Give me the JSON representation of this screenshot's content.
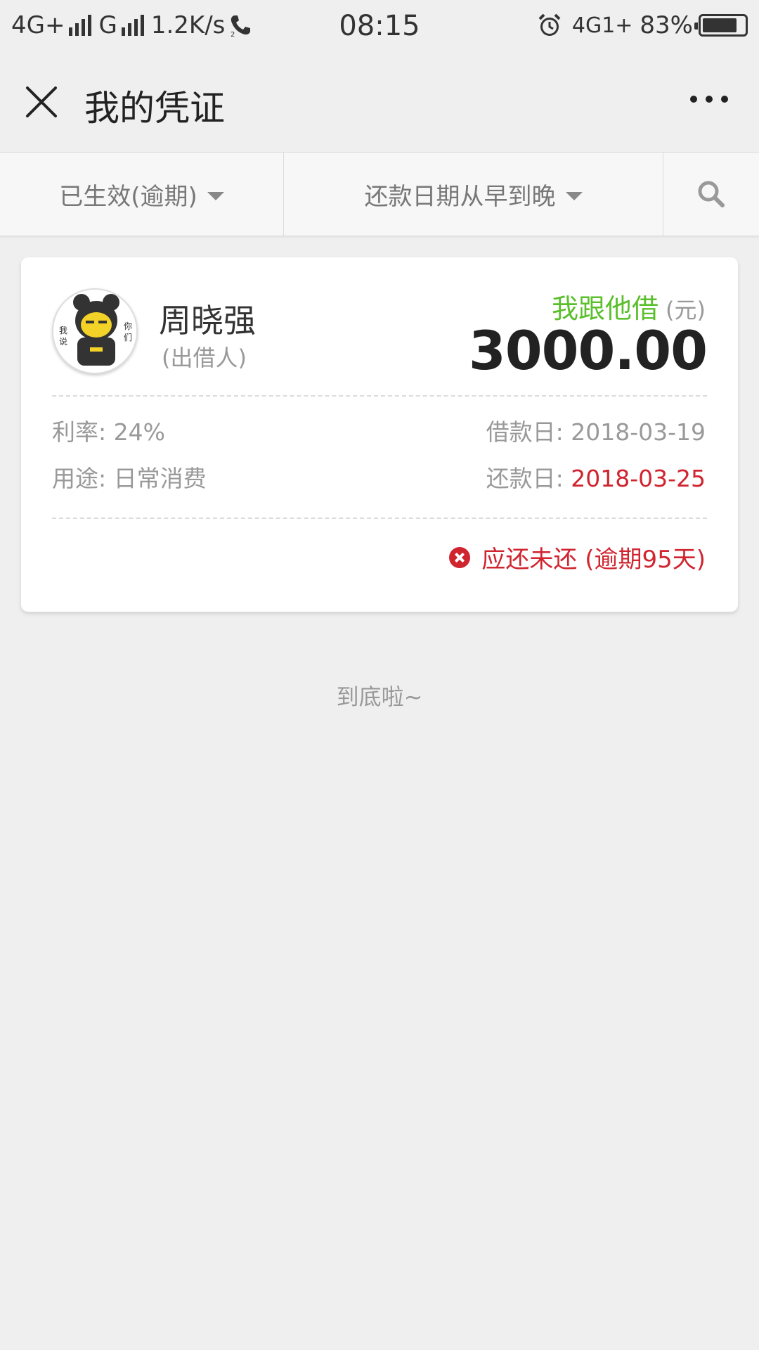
{
  "status_bar": {
    "network_left": "4G+",
    "network_g": "G",
    "speed": "1.2K/s",
    "time": "08:15",
    "network_right": "4G1+",
    "battery": "83%",
    "battery_level": 0.83
  },
  "navbar": {
    "title": "我的凭证"
  },
  "filters": {
    "status": "已生效(逾期)",
    "sort": "还款日期从早到晚"
  },
  "card": {
    "name": "周晓强",
    "role": "(出借人)",
    "borrow_label": "我跟他借",
    "unit": "(元)",
    "amount": "3000.00",
    "rate_label": "利率:",
    "rate_value": "24%",
    "purpose_label": "用途:",
    "purpose_value": "日常消费",
    "loan_date_label": "借款日:",
    "loan_date_value": "2018-03-19",
    "repay_date_label": "还款日:",
    "repay_date_value": "2018-03-25",
    "status_text": "应还未还 (逾期95天)"
  },
  "footer_text": "到底啦~",
  "colors": {
    "green": "#5bbf2c",
    "red": "#d0242f",
    "background": "#efeff0"
  }
}
